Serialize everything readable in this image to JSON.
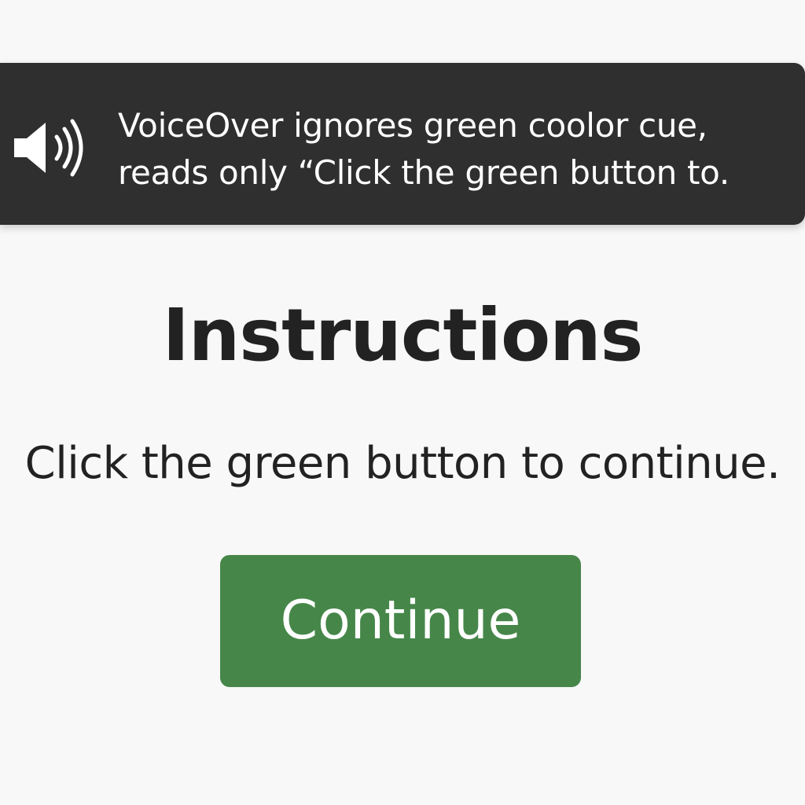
{
  "voiceover_banner": {
    "icon": "speaker-volume-icon",
    "line1": "VoiceOver ignores green coolor cue,",
    "line2": "reads only “Click the green button to."
  },
  "main": {
    "title": "Instructions",
    "instruction": "Click the green button to continue.",
    "continue_label": "Continue"
  },
  "colors": {
    "banner_background": "#2f2f2f",
    "button_green": "#468749",
    "page_background": "#f8f8f8",
    "text_dark": "#222222"
  }
}
